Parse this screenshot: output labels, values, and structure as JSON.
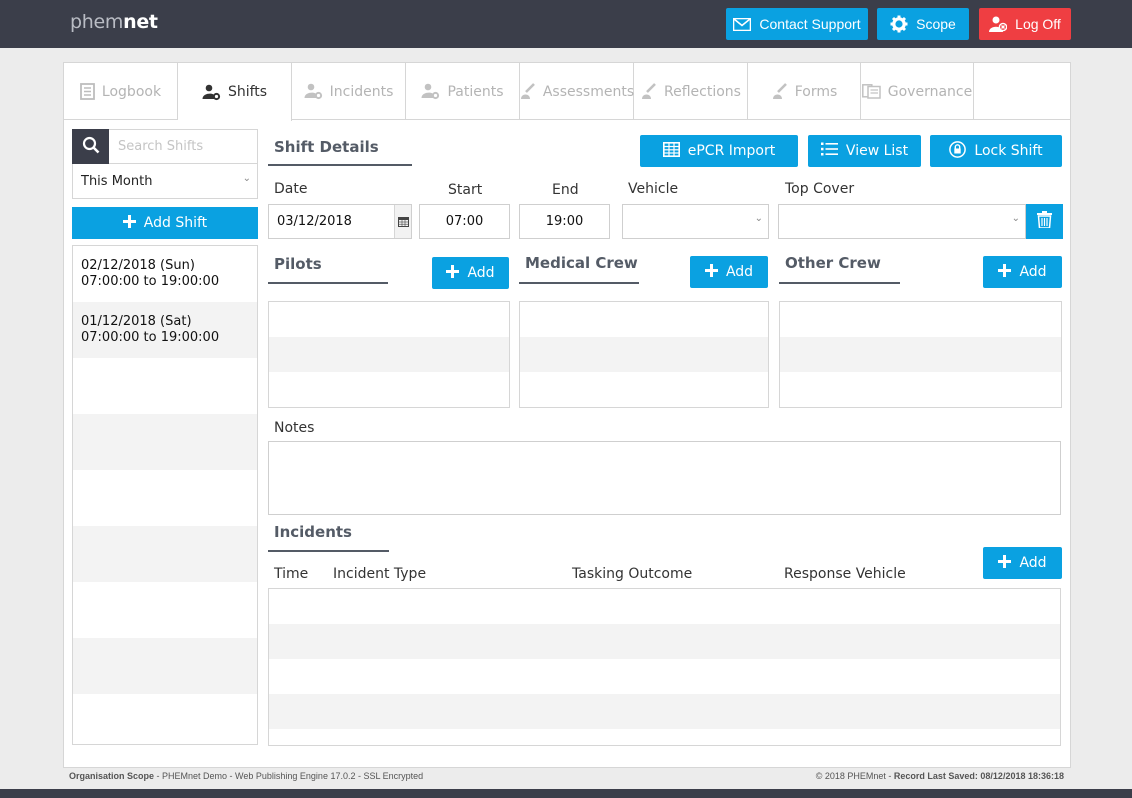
{
  "brand": {
    "logo_light": "phem",
    "logo_bold": "net"
  },
  "header": {
    "contact_support": "Contact Support",
    "scope": "Scope",
    "log_off": "Log Off"
  },
  "tabs": [
    {
      "label": "Logbook",
      "icon": "book-icon",
      "active": false
    },
    {
      "label": "Shifts",
      "icon": "user-gear-icon",
      "active": true
    },
    {
      "label": "Incidents",
      "icon": "user-gear-icon",
      "active": false
    },
    {
      "label": "Patients",
      "icon": "user-gear-icon",
      "active": false
    },
    {
      "label": "Assessments",
      "icon": "pen-user-icon",
      "active": false
    },
    {
      "label": "Reflections",
      "icon": "pen-user-icon",
      "active": false
    },
    {
      "label": "Forms",
      "icon": "pen-user-icon",
      "active": false
    },
    {
      "label": "Governance",
      "icon": "documents-icon",
      "active": false
    }
  ],
  "sidebar": {
    "search_placeholder": "Search Shifts",
    "filter_value": "This Month",
    "add_shift": "Add Shift",
    "shifts": [
      {
        "date": "02/12/2018 (Sun)",
        "time": "07:00:00 to 19:00:00"
      },
      {
        "date": "01/12/2018 (Sat)",
        "time": "07:00:00 to 19:00:00"
      }
    ]
  },
  "shift_details": {
    "title": "Shift Details",
    "epcr_import": "ePCR Import",
    "view_list": "View List",
    "lock_shift": "Lock Shift",
    "date_label": "Date",
    "date_value": "03/12/2018",
    "start_label": "Start",
    "start_value": "07:00",
    "end_label": "End",
    "end_value": "19:00",
    "vehicle_label": "Vehicle",
    "vehicle_value": "",
    "top_cover_label": "Top Cover",
    "top_cover_value": ""
  },
  "crew": {
    "pilots_title": "Pilots",
    "medical_title": "Medical Crew",
    "other_title": "Other Crew",
    "add_label": "Add"
  },
  "notes": {
    "label": "Notes",
    "value": ""
  },
  "incidents": {
    "title": "Incidents",
    "add_label": "Add",
    "columns": [
      "Time",
      "Incident Type",
      "Tasking Outcome",
      "Response Vehicle"
    ]
  },
  "footer": {
    "scope_label": "Organisation Scope",
    "scope_text": " - PHEMnet Demo - Web Publishing Engine 17.0.2 - SSL Encrypted",
    "copyright": "© 2018 PHEMnet - ",
    "saved_label": "Record Last Saved: 08/12/2018 18:36:18"
  },
  "colors": {
    "accent": "#0aa1e1",
    "danger": "#ef3e42",
    "dark": "#3b3e4a"
  }
}
